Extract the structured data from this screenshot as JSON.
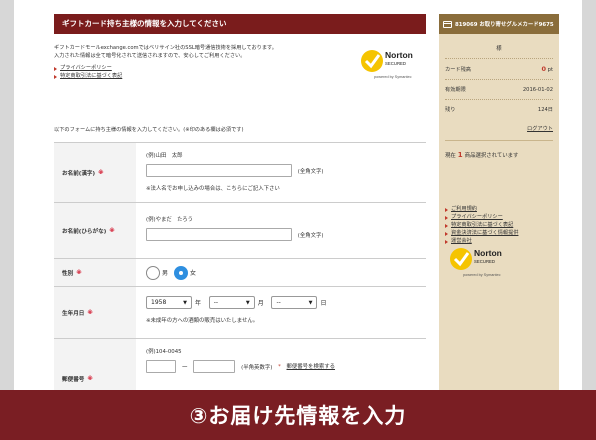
{
  "main": {
    "header": "ギフトカード持ち主様の情報を入力してください",
    "intro_line1": "ギフトカードモールexchange.comではベリサイン社のSSL暗号通信技術を採用しております。",
    "intro_line2": "入力された情報は全て暗号化されて送信されますので、安心してご利用ください。",
    "links": [
      "プライバシーポリシー",
      "特定商取引法に基づく表記"
    ],
    "norton": {
      "top": "ABOUT SSL CERTIFICATES",
      "brand": "Norton",
      "secured": "SECURED",
      "powered": "powered by Symantec"
    },
    "instruction": "以下のフォームに持ち主様の情報を入力してください。(※印のある欄は必須です)"
  },
  "form": {
    "required_mark": "※",
    "name_kanji": {
      "label": "お名前(漢字)",
      "example": "(例)山田　太郎",
      "hint": "(全角文字)",
      "note": "※法人名でお申し込みの場合は、こちらにご記入下さい"
    },
    "name_kana": {
      "label": "お名前(ひらがな)",
      "example": "(例)やまだ　たろう",
      "hint": "(全角文字)"
    },
    "gender": {
      "label": "性別",
      "options": [
        "男",
        "女"
      ],
      "selected": "女"
    },
    "birthdate": {
      "label": "生年月日",
      "year": "1958",
      "year_unit": "年",
      "month": "--",
      "month_unit": "月",
      "day": "--",
      "day_unit": "日",
      "note": "※未成年の方への酒類の販売はいたしません。"
    },
    "postal": {
      "label": "郵便番号",
      "example": "(例)104-0045",
      "dash": "ー",
      "hint": "(半角英数字)",
      "asterisk": "*",
      "search_link": "郵便番号を検索する"
    }
  },
  "sidebar": {
    "card_title": "819069 お取り寄せグルメカード9675",
    "sama": "様",
    "rows": [
      {
        "label": "カード残高",
        "value": "0",
        "unit": "pt"
      },
      {
        "label": "有効期限",
        "value": "2016-01-02"
      },
      {
        "label": "残り",
        "value": "124日"
      }
    ],
    "logout": "ログアウト",
    "selected_prefix": "現在",
    "selected_count": "1",
    "selected_suffix": "商品選択されています",
    "links": [
      "ご利用規約",
      "プライバシーポリシー",
      "特定商取引法に基づく表記",
      "資金決済法に基づく情報提供",
      "運営会社"
    ]
  },
  "banner": {
    "text": "③お届け先情報を入力"
  },
  "colors": {
    "header_bg": "#7a1c1c",
    "sidebar_bg": "#e9dcc0",
    "sidebar_header": "#8a6d3b",
    "accent_red": "#c0392b",
    "radio_selected": "#2f8fe0",
    "banner_bg": "#7a1e23"
  }
}
